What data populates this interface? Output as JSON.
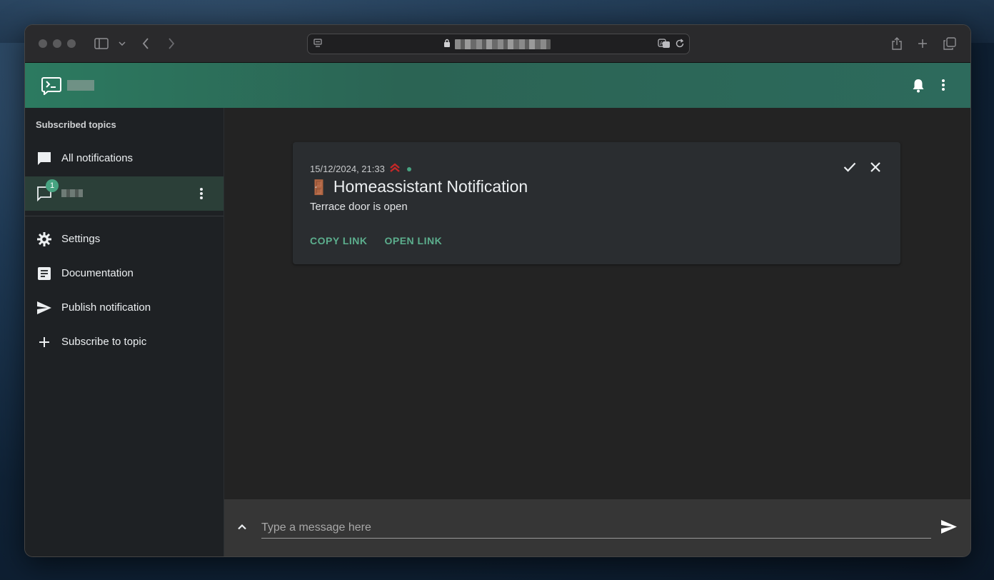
{
  "browser": {
    "icons": [
      "sidebar-toggle-icon",
      "chevron-down-icon",
      "back-icon",
      "forward-icon",
      "share-icon",
      "new-tab-icon",
      "tabs-overview-icon",
      "translate-icon",
      "reload-icon",
      "lock-icon",
      "page-icon"
    ]
  },
  "app": {
    "accent_color": "#2b6454",
    "header_icons": [
      "bell-icon",
      "more-vert-icon"
    ]
  },
  "sidebar": {
    "header": "Subscribed topics",
    "items": [
      {
        "label": "All notifications",
        "icon": "chat-icon"
      },
      {
        "label": "",
        "icon": "chat-outline-icon",
        "badge": "1",
        "active": true
      },
      {
        "label": "Settings",
        "icon": "gear-icon"
      },
      {
        "label": "Documentation",
        "icon": "article-icon"
      },
      {
        "label": "Publish notification",
        "icon": "send-icon"
      },
      {
        "label": "Subscribe to topic",
        "icon": "plus-icon"
      }
    ]
  },
  "notification": {
    "timestamp": "15/12/2024, 21:33",
    "priority_icon": "priority-high-icon",
    "emoji": "🚪",
    "title": "Homeassistant Notification",
    "body": "Terrace door is open",
    "actions": [
      "COPY LINK",
      "OPEN LINK"
    ],
    "priority_color": "#c62828"
  },
  "composer": {
    "placeholder": "Type a message here"
  }
}
